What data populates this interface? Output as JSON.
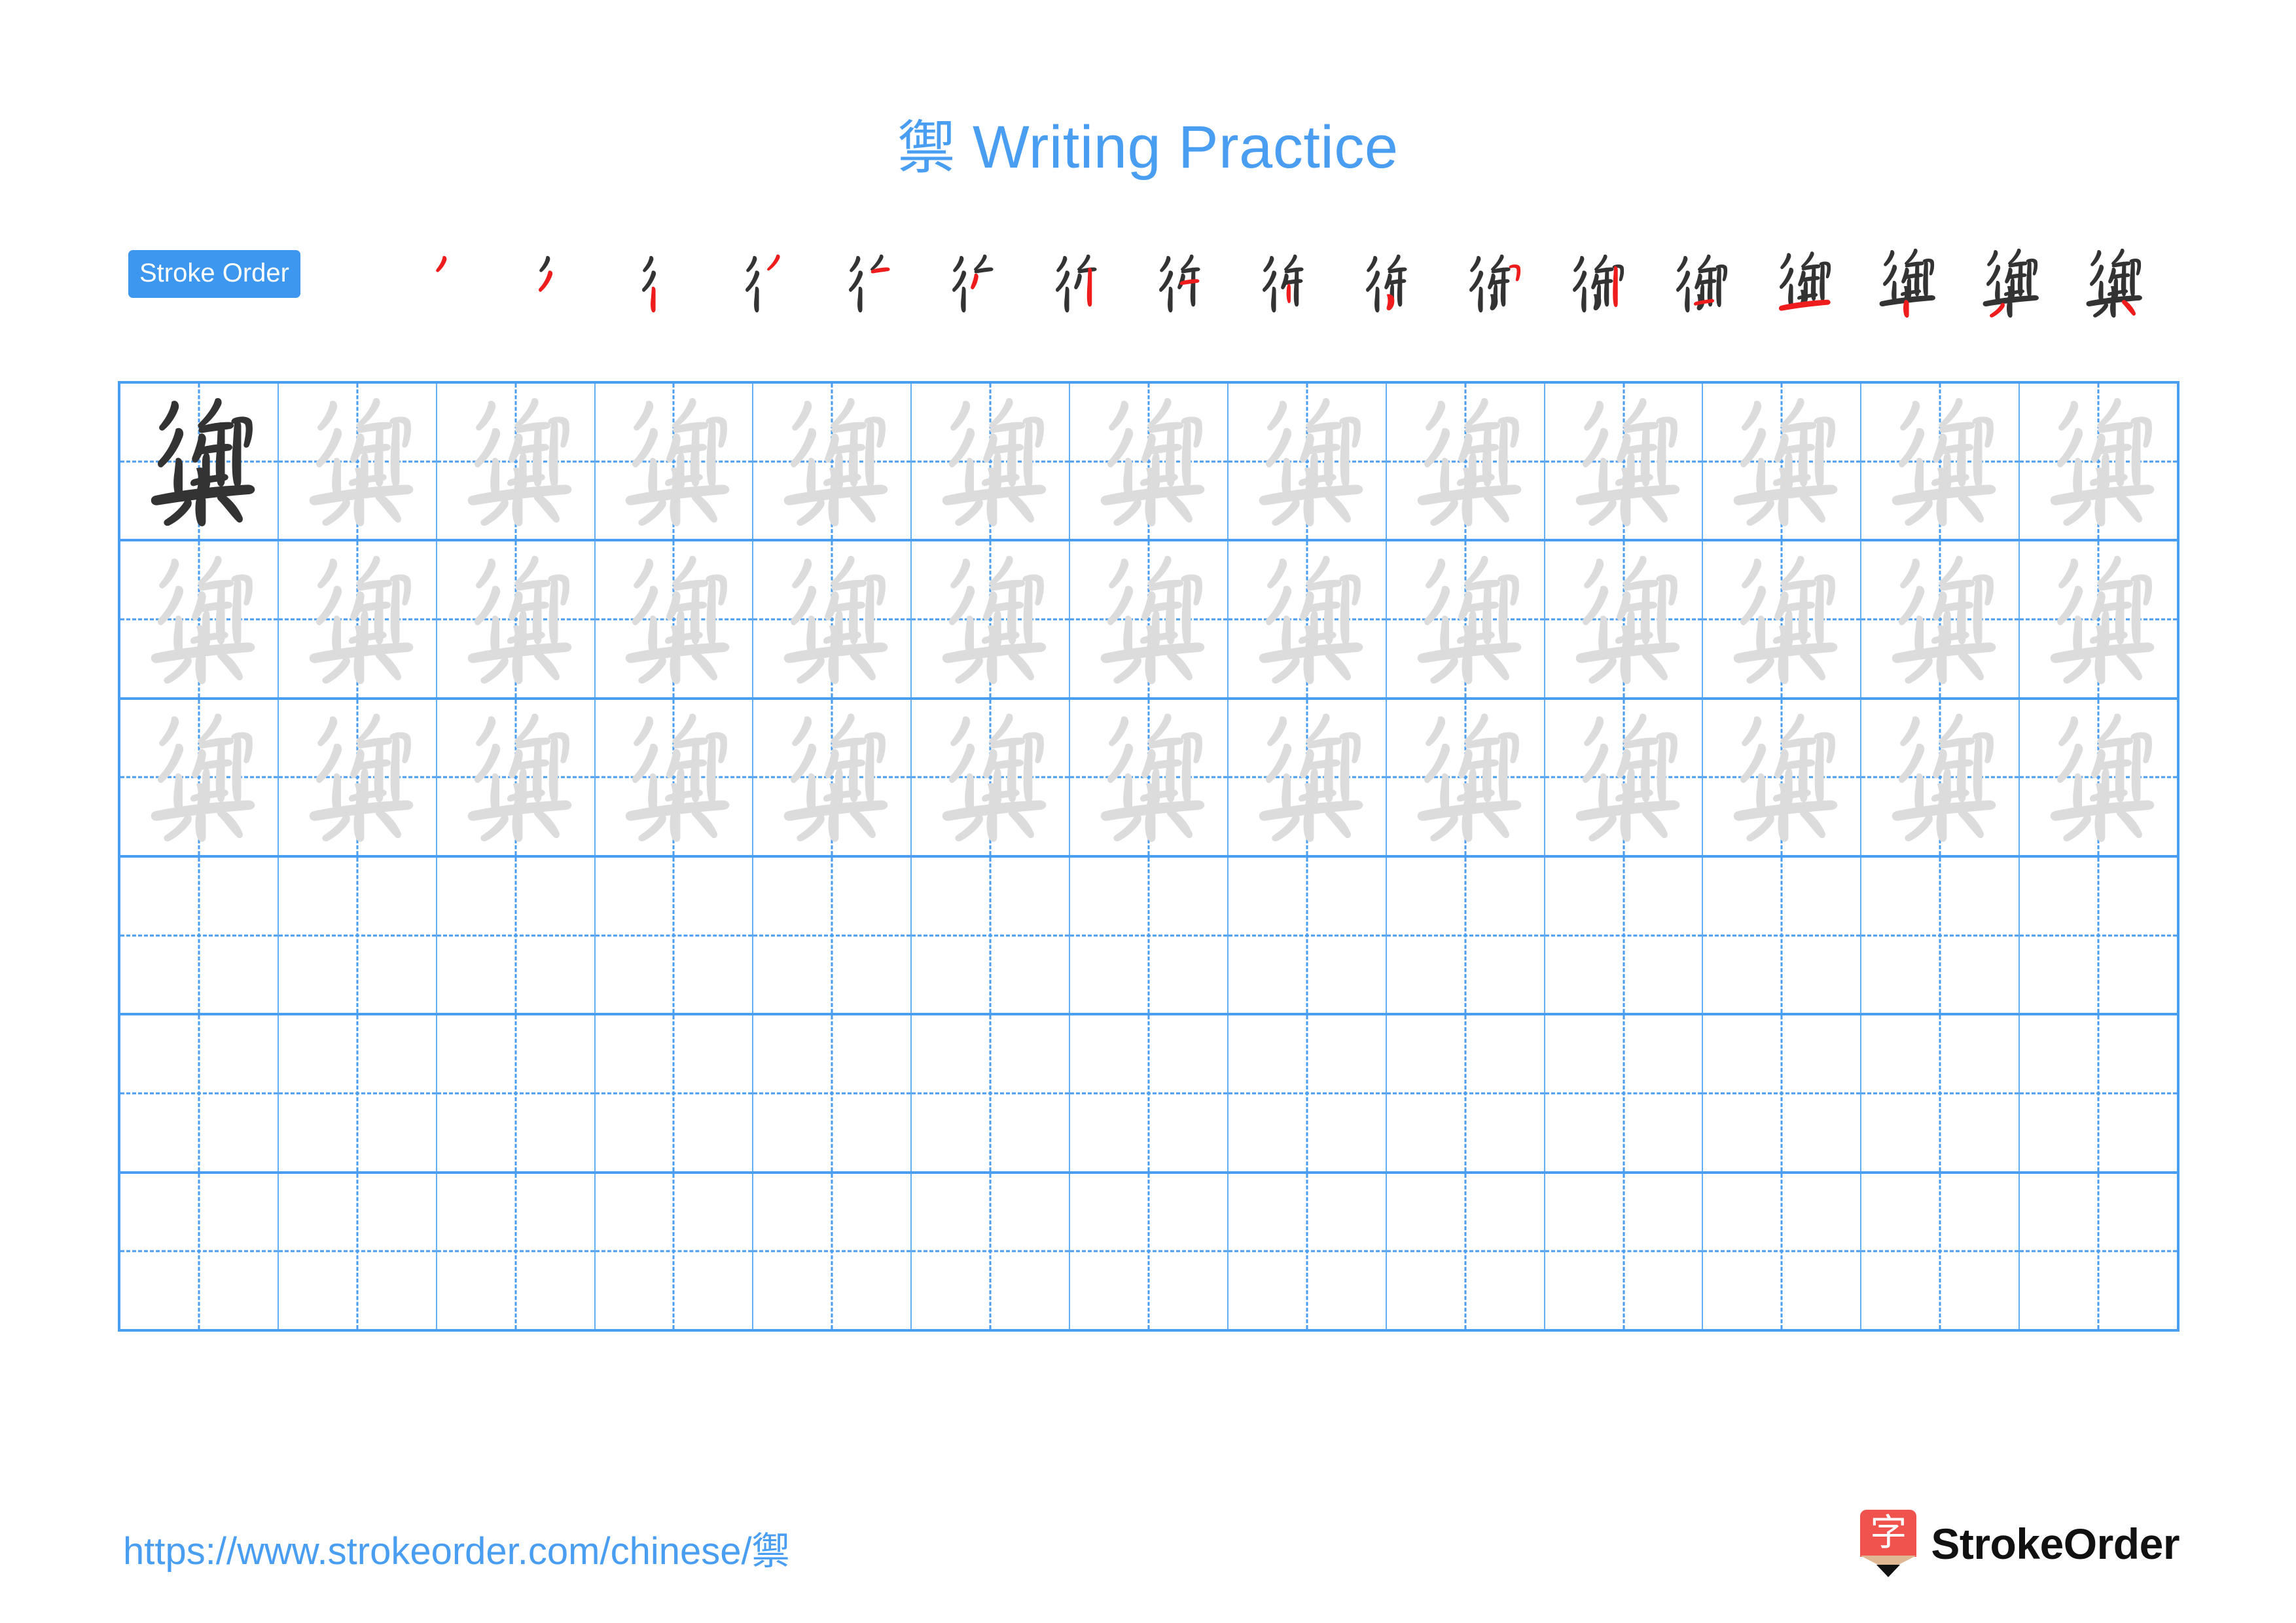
{
  "document": {
    "character": "禦",
    "title_suffix": " Writing Practice",
    "title_full": "禦 Writing Practice",
    "type": "chinese-character-writing-practice-worksheet"
  },
  "colors": {
    "accent_blue": "#4a9ef2",
    "badge_blue": "#3d97ee",
    "grid_line": "#4a9ef2",
    "grid_line_thin": "#63aef5",
    "stroke_done": "#333333",
    "stroke_new": "#ee1c1c",
    "trace_gray": "#dcdcdc",
    "logo_red": "#f0524d",
    "logo_wood": "#dfb792"
  },
  "stroke_order": {
    "badge_label": "Stroke Order",
    "total_strokes": 17,
    "steps": [
      {
        "index": 1,
        "new_stroke": "pie-dot"
      },
      {
        "index": 2,
        "new_stroke": "pie"
      },
      {
        "index": 3,
        "new_stroke": "shu"
      },
      {
        "index": 4,
        "new_stroke": "pie-short"
      },
      {
        "index": 5,
        "new_stroke": "heng"
      },
      {
        "index": 6,
        "new_stroke": "heng-zhe"
      },
      {
        "index": 7,
        "new_stroke": "shu-2"
      },
      {
        "index": 8,
        "new_stroke": "heng-2"
      },
      {
        "index": 9,
        "new_stroke": "shu-3"
      },
      {
        "index": 10,
        "new_stroke": "na"
      },
      {
        "index": 11,
        "new_stroke": "heng-zhe-gou"
      },
      {
        "index": 12,
        "new_stroke": "shu-4"
      },
      {
        "index": 13,
        "new_stroke": "heng-3"
      },
      {
        "index": 14,
        "new_stroke": "heng-long"
      },
      {
        "index": 15,
        "new_stroke": "shu-gou"
      },
      {
        "index": 16,
        "new_stroke": "pie-left"
      },
      {
        "index": 17,
        "new_stroke": "dian-right"
      }
    ]
  },
  "practice_grid": {
    "columns": 13,
    "rows": 6,
    "rows_data": [
      {
        "row": 1,
        "filled": true,
        "cells": [
          "dark",
          "light",
          "light",
          "light",
          "light",
          "light",
          "light",
          "light",
          "light",
          "light",
          "light",
          "light",
          "light"
        ]
      },
      {
        "row": 2,
        "filled": true,
        "cells": [
          "light",
          "light",
          "light",
          "light",
          "light",
          "light",
          "light",
          "light",
          "light",
          "light",
          "light",
          "light",
          "light"
        ]
      },
      {
        "row": 3,
        "filled": true,
        "cells": [
          "light",
          "light",
          "light",
          "light",
          "light",
          "light",
          "light",
          "light",
          "light",
          "light",
          "light",
          "light",
          "light"
        ]
      },
      {
        "row": 4,
        "filled": false,
        "cells": [
          "empty",
          "empty",
          "empty",
          "empty",
          "empty",
          "empty",
          "empty",
          "empty",
          "empty",
          "empty",
          "empty",
          "empty",
          "empty"
        ]
      },
      {
        "row": 5,
        "filled": false,
        "cells": [
          "empty",
          "empty",
          "empty",
          "empty",
          "empty",
          "empty",
          "empty",
          "empty",
          "empty",
          "empty",
          "empty",
          "empty",
          "empty"
        ]
      },
      {
        "row": 6,
        "filled": false,
        "cells": [
          "empty",
          "empty",
          "empty",
          "empty",
          "empty",
          "empty",
          "empty",
          "empty",
          "empty",
          "empty",
          "empty",
          "empty",
          "empty"
        ]
      }
    ]
  },
  "footer": {
    "url": "https://www.strokeorder.com/chinese/禦",
    "url_base": "https://www.strokeorder.com/chinese/",
    "brand_name": "StrokeOrder",
    "logo_character": "字"
  }
}
